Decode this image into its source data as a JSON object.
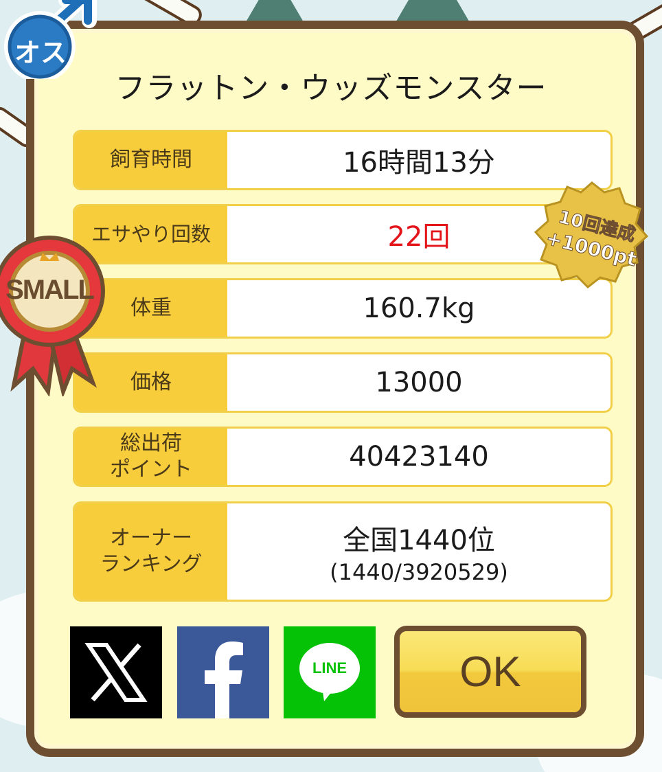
{
  "gender_badge": {
    "text": "オス"
  },
  "rank_ribbon": {
    "text": "SMALL"
  },
  "bonus_seal": {
    "line1": "10回達成",
    "line2": "+1000pt"
  },
  "title": "フラットン・ウッズモンスター",
  "rows": [
    {
      "label": "飼育時間",
      "value": "16時間13分"
    },
    {
      "label": "エサやり回数",
      "value": "22回"
    },
    {
      "label": "体重",
      "value": "160.7kg"
    },
    {
      "label": "価格",
      "value": "13000"
    },
    {
      "label_line1": "総出荷",
      "label_line2": "ポイント",
      "value": "40423140"
    },
    {
      "label_line1": "オーナー",
      "label_line2": "ランキング",
      "value": "全国1440位",
      "sub": "(1440/3920529)"
    }
  ],
  "buttons": {
    "line": "LINE",
    "ok": "OK"
  },
  "colors": {
    "frame": "#6e4e31",
    "panel": "#fffbc7",
    "label_bg": "#f8cd3c",
    "highlight": "#e4141b"
  }
}
